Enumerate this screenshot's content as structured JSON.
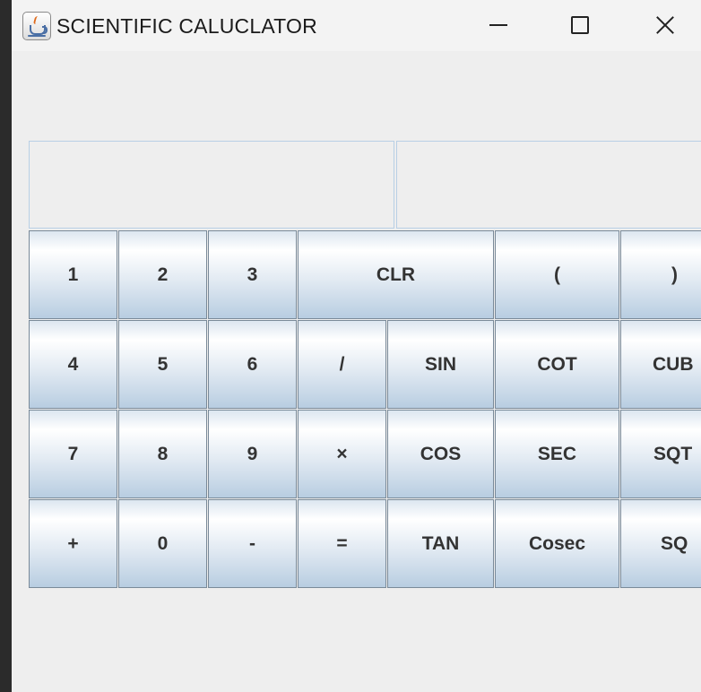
{
  "window": {
    "title": "SCIENTIFIC CALUCLATOR"
  },
  "display": {
    "expression": "",
    "result": ""
  },
  "buttons": {
    "one": "1",
    "two": "2",
    "three": "3",
    "clr": "CLR",
    "open_paren": "(",
    "close_paren": ")",
    "four": "4",
    "five": "5",
    "six": "6",
    "divide": "/",
    "sin": "SIN",
    "cot": "COT",
    "cub": "CUB",
    "seven": "7",
    "eight": "8",
    "nine": "9",
    "multiply": "×",
    "cos": "COS",
    "sec": "SEC",
    "sqt": "SQT",
    "plus": "+",
    "zero": "0",
    "minus": "-",
    "equals": "=",
    "tan": "TAN",
    "cosec": "Cosec",
    "sq": "SQ"
  },
  "colors": {
    "button_gradient_top": "#ffffff",
    "button_gradient_bottom": "#b8cde1",
    "button_border": "#7a8a99",
    "window_bg": "#eeeeee",
    "display_border": "#b8cfe5"
  },
  "icons": {
    "app": "java-cup-icon"
  }
}
